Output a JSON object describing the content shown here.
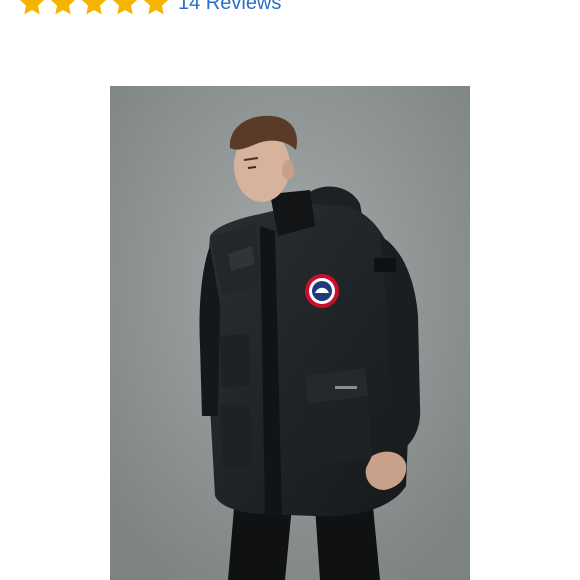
{
  "rating": {
    "stars": 5,
    "star_color": "#f5b400",
    "reviews_text": "14 Reviews",
    "link_color": "#2a6fc9"
  },
  "product_image": {
    "icons": [
      "star-icon"
    ]
  }
}
